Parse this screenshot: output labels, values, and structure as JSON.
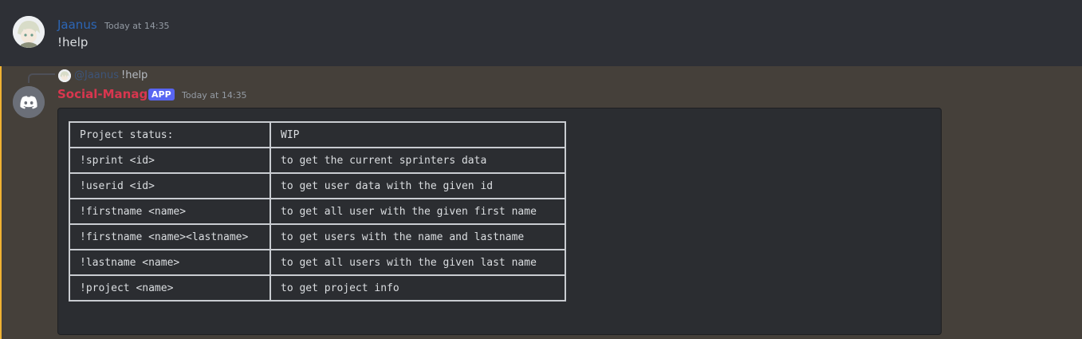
{
  "message1": {
    "username": "Jaanus",
    "timestamp": "Today at 14:35",
    "content": "!help"
  },
  "message2": {
    "reply": {
      "mention": "@Jaanus",
      "text": "!help"
    },
    "username": "Social-Manager",
    "badge": "APP",
    "timestamp": "Today at 14:35",
    "table": [
      [
        "Project status:",
        "WIP"
      ],
      [
        "!sprint <id>",
        "to get the current sprinters data"
      ],
      [
        "!userid <id>",
        "to get user data with the given id"
      ],
      [
        "!firstname <name>",
        "to get all user with the given first name"
      ],
      [
        "!firstname <name><lastname>",
        "to get users with the name and lastname"
      ],
      [
        "!lastname <name>",
        "to get all users with the given last name"
      ],
      [
        "!project <name>",
        "to get project info"
      ]
    ]
  },
  "colors": {
    "background": "#2b2d31",
    "mention_highlight": "#45403a",
    "mention_bar": "#f0b232",
    "bot_name": "#d9364f",
    "user_name": "#2c66b6",
    "app_badge": "#5865f2"
  },
  "icons": [
    "user-avatar",
    "discord-bot-avatar"
  ]
}
